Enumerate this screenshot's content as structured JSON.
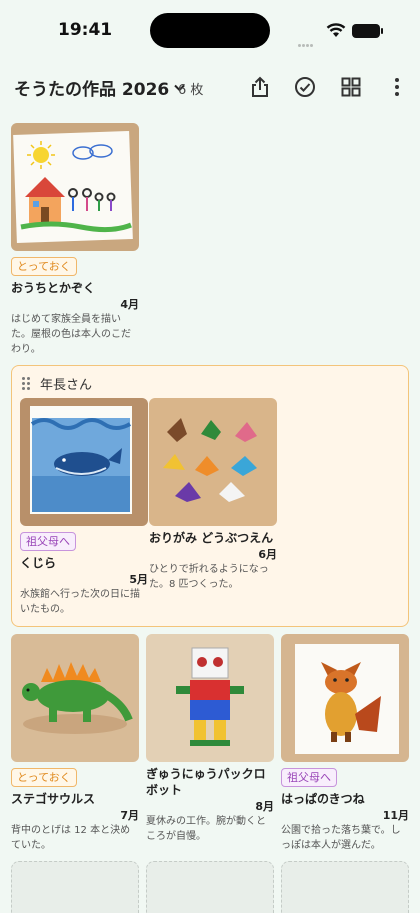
{
  "status": {
    "time": "19:41"
  },
  "header": {
    "title": "そうたの作品 2026",
    "count": "6 枚"
  },
  "items": [
    {
      "title": "おうちとかぞく",
      "badge": "とっておく",
      "month": "4月",
      "note": "はじめて家族全員を描いた。屋根の色は本人のこだわり。"
    },
    {
      "title": "くじら",
      "badge": "祖父母へ",
      "month": "5月",
      "note": "水族館へ行った次の日に描いたもの。"
    },
    {
      "title": "おりがみ どうぶつえん",
      "badge": "",
      "month": "6月",
      "note": "ひとりで折れるようになった。8 匹つくった。"
    },
    {
      "title": "ステゴサウルス",
      "badge": "とっておく",
      "month": "7月",
      "note": "背中のとげは 12 本と決めていた。"
    },
    {
      "title": "ぎゅうにゅうパックロボット",
      "badge": "",
      "month": "8月",
      "note": "夏休みの工作。腕が動くところが自慢。"
    },
    {
      "title": "はっぱのきつね",
      "badge": "祖父母へ",
      "month": "11月",
      "note": "公園で拾った落ち葉で。しっぽは本人が選んだ。"
    }
  ],
  "group": {
    "label": "年長さん"
  },
  "colors": {
    "background": "#f1f8f3",
    "accent_orange": "#e08a1e",
    "accent_purple": "#9a47b8",
    "group_border": "#f3c47a"
  }
}
